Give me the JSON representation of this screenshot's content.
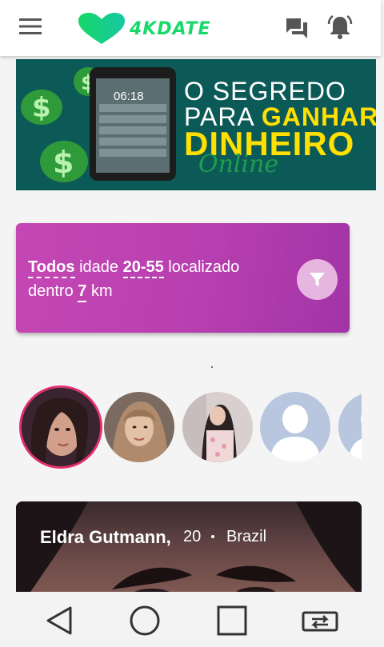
{
  "header": {
    "logo_text": "4KDATE",
    "icons": [
      "menu-icon",
      "heart-logo-icon",
      "chat-icon",
      "bell-icon"
    ],
    "accent_color": "#19d86a"
  },
  "banner": {
    "line1": "O SEGREDO",
    "line2_prefix": "PARA ",
    "line2_highlight": "GANHAR",
    "line3": "DINHEIRO",
    "line4": "Online",
    "phone_time": "06:18"
  },
  "filter": {
    "gender_value": "Todos",
    "age_label": "idade",
    "age_value": "20-55",
    "location_label": "localizado",
    "within_label": "dentro",
    "distance_value": "7",
    "distance_unit": "km",
    "button_icon": "filter-icon",
    "card_color": "#c046b4"
  },
  "stories": {
    "count": 5,
    "active_border_color": "#e0306d"
  },
  "profile": {
    "name": "Eldra Gutmann,",
    "age": "20",
    "country": "Brazil"
  },
  "navbar": {
    "icons": [
      "back-icon",
      "home-icon",
      "recents-icon",
      "screen-rotate-icon"
    ]
  }
}
